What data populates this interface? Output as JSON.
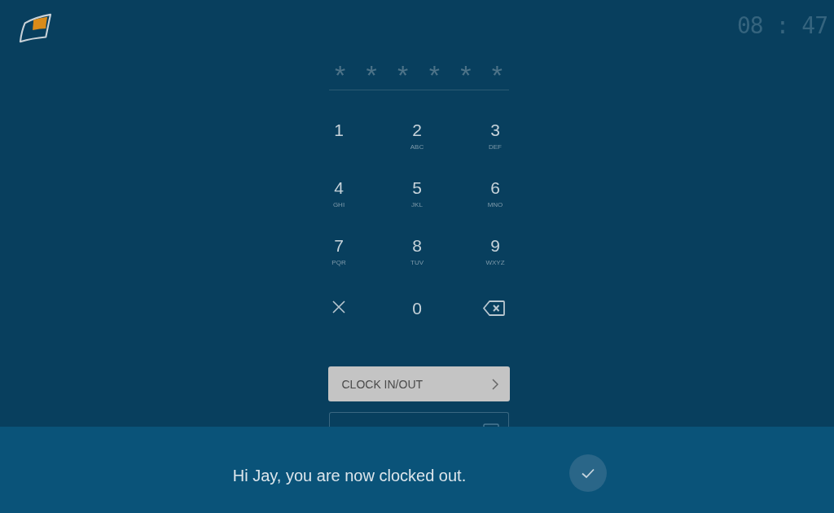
{
  "clock": "08 : 47",
  "pin_mask": [
    "*",
    "*",
    "*",
    "*",
    "*",
    "*"
  ],
  "keypad": [
    {
      "kind": "digit",
      "digit": "1"
    },
    {
      "kind": "digit",
      "digit": "2",
      "letters": "ABC"
    },
    {
      "kind": "digit",
      "digit": "3",
      "letters": "DEF"
    },
    {
      "kind": "digit",
      "digit": "4",
      "letters": "GHI"
    },
    {
      "kind": "digit",
      "digit": "5",
      "letters": "JKL"
    },
    {
      "kind": "digit",
      "digit": "6",
      "letters": "MNO"
    },
    {
      "kind": "digit",
      "digit": "7",
      "letters": "PQR"
    },
    {
      "kind": "digit",
      "digit": "8",
      "letters": "TUV"
    },
    {
      "kind": "digit",
      "digit": "9",
      "letters": "WXYZ"
    },
    {
      "kind": "clear"
    },
    {
      "kind": "digit",
      "digit": "0"
    },
    {
      "kind": "backspace"
    }
  ],
  "buttons": [
    {
      "kind": "primary",
      "label": "CLOCK IN/OUT"
    },
    {
      "kind": "outline"
    }
  ],
  "toast": {
    "message": "Hi Jay, you are now clocked out."
  }
}
